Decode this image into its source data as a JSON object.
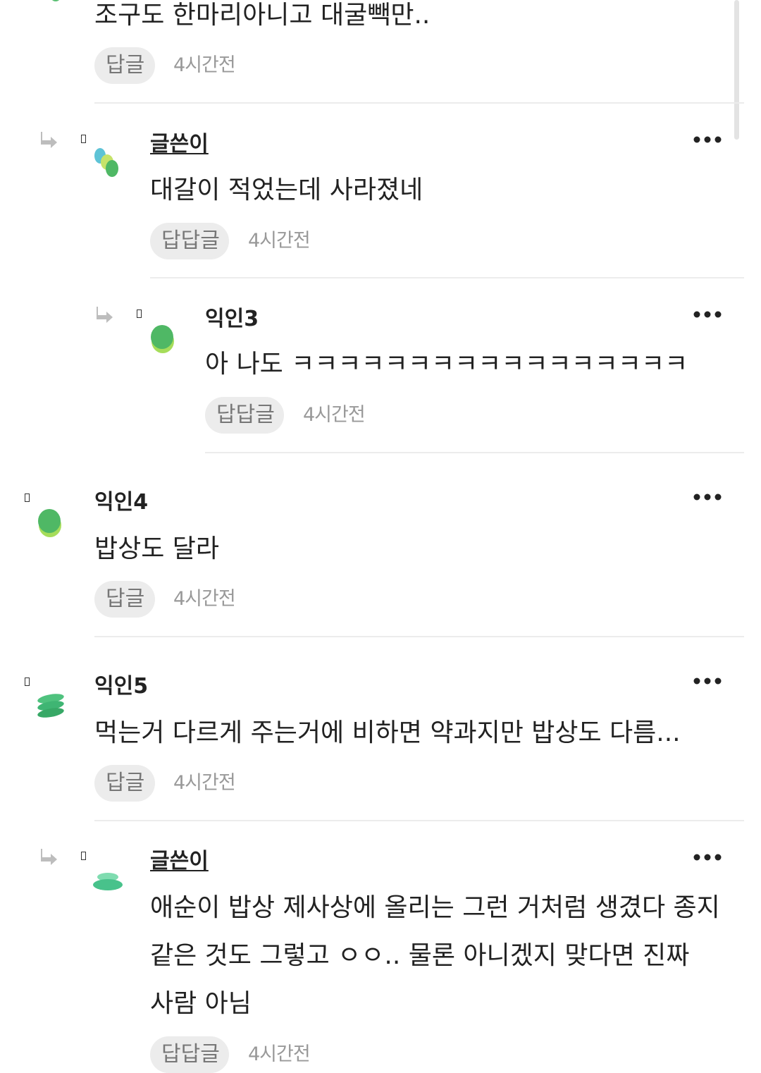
{
  "scrollbar_color": "#e3e3e3",
  "accent_green": "#5bbf73",
  "comments": [
    {
      "id": "top-partial",
      "text": "조구도 한마리아니고 대굴빽만..",
      "reply_label": "답글",
      "time": "4시간전"
    },
    {
      "id": "reply-author-1",
      "nickname": "글쓴이",
      "text": "대갈이 적었는데 사라졌네",
      "reply_label": "답답글",
      "time": "4시간전",
      "icon": "reply-arrow-icon"
    },
    {
      "id": "reply-ikin3",
      "nickname": "익인3",
      "text": "아 나도 ㅋㅋㅋㅋㅋㅋㅋㅋㅋㅋㅋㅋㅋㅋㅋㅋㅋ",
      "reply_label": "답답글",
      "time": "4시간전",
      "icon": "reply-arrow-icon"
    },
    {
      "id": "comment-ikin4",
      "nickname": "익인4",
      "text": "밥상도 달라",
      "reply_label": "답글",
      "time": "4시간전"
    },
    {
      "id": "comment-ikin5",
      "nickname": "익인5",
      "text": "먹는거 다르게 주는거에 비하면 약과지만 밥상도 다름...",
      "reply_label": "답글",
      "time": "4시간전"
    },
    {
      "id": "reply-author-2",
      "nickname": "글쓴이",
      "text": "애순이 밥상 제사상에 올리는 그런 거처럼 생겼다 종지 같은 것도 그렇고 ㅇㅇ.. 물론 아니겠지 맞다면 진짜 사람 아님",
      "reply_label": "답답글",
      "time": "4시간전",
      "icon": "reply-arrow-icon"
    }
  ]
}
